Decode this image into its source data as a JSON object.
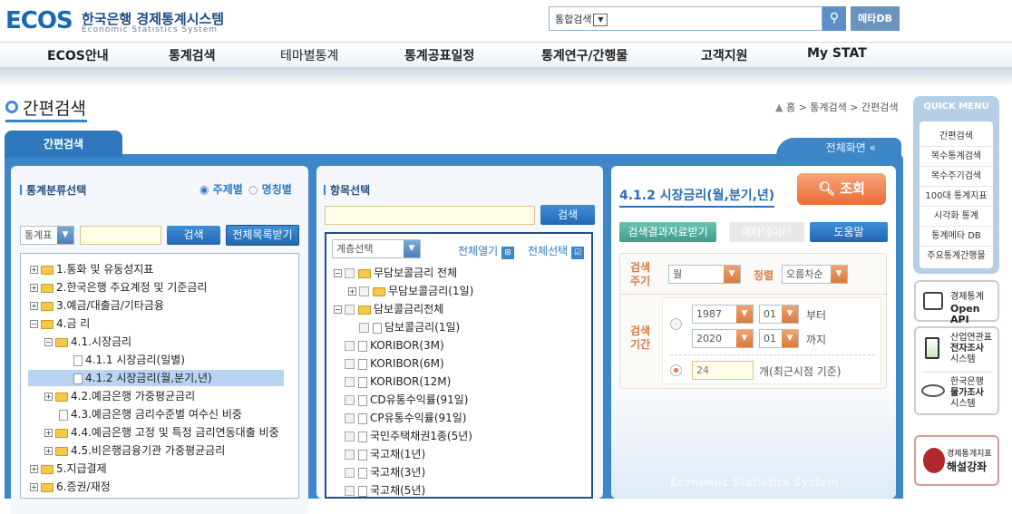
{
  "header": {
    "logo_big": "ECOS",
    "logo_ko": "한국은행 경제통계시스템",
    "logo_en": "Economic Statistics System",
    "search_select": "통합검색",
    "meta_label": "메타DB"
  },
  "gnb": [
    "ECOS안내",
    "통계검색",
    "테마별통계",
    "통계공표일정",
    "통계연구/간행물",
    "고객지원",
    "My STAT"
  ],
  "page": {
    "title": "간편검색",
    "breadcrumb": "홈 > 통계검색 > 간편검색",
    "tab": "간편검색",
    "full_screen": "전체화면 «"
  },
  "p1": {
    "title": "통계분류선택",
    "radio_subject": "주제별",
    "radio_name": "명칭별",
    "select": "통계표",
    "search": "검색",
    "download": "전체목록받기",
    "tree": [
      "1.통화 및 유동성지표",
      "2.한국은행 주요계정 및 기준금리",
      "3.예금/대출금/기타금융",
      "4.금 리",
      "4.1.시장금리",
      "4.1.1 시장금리(일별)",
      "4.1.2 시장금리(월,분기,년)",
      "4.2.예금은행 가중평균금리",
      "4.3.예금은행 금리수준별 여수신 비중",
      "4.4.예금은행 고정 및 특정 금리연동대출 비중",
      "4.5.비은행금융기관 가중평균금리",
      "5.지급결제",
      "6.증권/재정"
    ]
  },
  "p2": {
    "title": "항목선택",
    "search": "검색",
    "level": "계층선택",
    "expand_all": "전체열기",
    "select_all": "전체선택",
    "items": [
      "무담보콜금리 전체",
      "무담보콜금리(1일)",
      "담보콜금리전체",
      "담보콜금리(1일)",
      "KORIBOR(3M)",
      "KORIBOR(6M)",
      "KORIBOR(12M)",
      "CD유통수익률(91일)",
      "CP유통수익률(91일)",
      "국민주택채권1종(5년)",
      "국고채(1년)",
      "국고채(3년)",
      "국고채(5년)"
    ]
  },
  "p3": {
    "title": "4.1.2 시장금리(월,분기,년)",
    "query": "조회",
    "download": "검색결과자료받기",
    "metadata": "메타데이터",
    "help": "도움말",
    "cycle_label": "검색\n주기",
    "cycle": "월",
    "sort_label": "정렬",
    "sort": "오름차순",
    "period_label": "검색\n기간",
    "from_year": "1987",
    "from_month": "01",
    "from_text": "부터",
    "to_year": "2020",
    "to_month": "01",
    "to_text": "까지",
    "recent": "24",
    "recent_text": "개(최근시점 기준)",
    "watermark": "Economic Statistics System"
  },
  "quick": {
    "title": "QUICK MENU",
    "items": [
      "간편검색",
      "복수통계검색",
      "복수주기검색",
      "100대 통계지표",
      "시각화 통계",
      "통계메타 DB",
      "주요통계간행물"
    ],
    "openapi_1": "경제통계",
    "openapi_2": "Open API",
    "survey_1": "산업연관표",
    "survey_2": "전자조사",
    "survey_3": "시스템",
    "price_1": "한국은행",
    "price_2": "물가조사",
    "price_3": "시스템",
    "lecture_1": "경제통계지표",
    "lecture_2": "해설강좌"
  }
}
